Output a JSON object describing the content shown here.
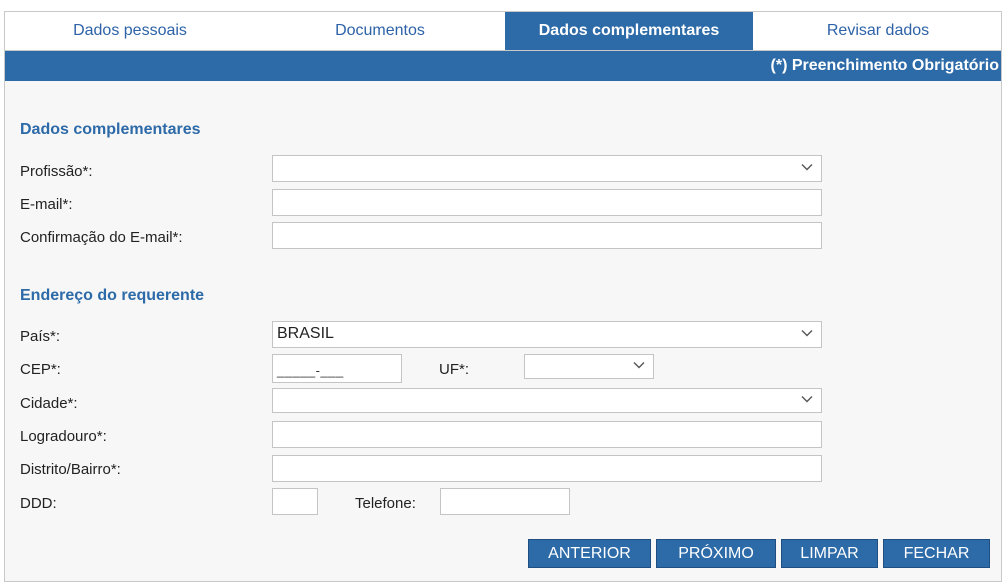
{
  "tabs": [
    {
      "label": "Dados pessoais"
    },
    {
      "label": "Documentos"
    },
    {
      "label": "Dados complementares"
    },
    {
      "label": "Revisar dados"
    }
  ],
  "required_note": "(*) Preenchimento Obrigatório",
  "sections": {
    "complementares": {
      "title": "Dados complementares",
      "profissao_label": "Profissão*:",
      "profissao_value": "",
      "email_label": "E-mail*:",
      "email_value": "",
      "email_confirm_label": "Confirmação do E-mail*:",
      "email_confirm_value": ""
    },
    "endereco": {
      "title": "Endereço do requerente",
      "pais_label": "País*:",
      "pais_value": "BRASIL",
      "cep_label": "CEP*:",
      "cep_mask": "_____-___",
      "uf_label": "UF*:",
      "uf_value": "",
      "cidade_label": "Cidade*:",
      "cidade_value": "",
      "logradouro_label": "Logradouro*:",
      "logradouro_value": "",
      "bairro_label": "Distrito/Bairro*:",
      "bairro_value": "",
      "ddd_label": "DDD:",
      "ddd_value": "",
      "telefone_label": "Telefone:",
      "telefone_value": ""
    }
  },
  "buttons": {
    "anterior": "ANTERIOR",
    "proximo": "PRÓXIMO",
    "limpar": "LIMPAR",
    "fechar": "FECHAR"
  },
  "colors": {
    "primary": "#2d6aa8",
    "link": "#2d62a8",
    "panel_bg": "#f7f7f7"
  },
  "icons": {
    "select_arrow": "chevron-down-icon"
  }
}
